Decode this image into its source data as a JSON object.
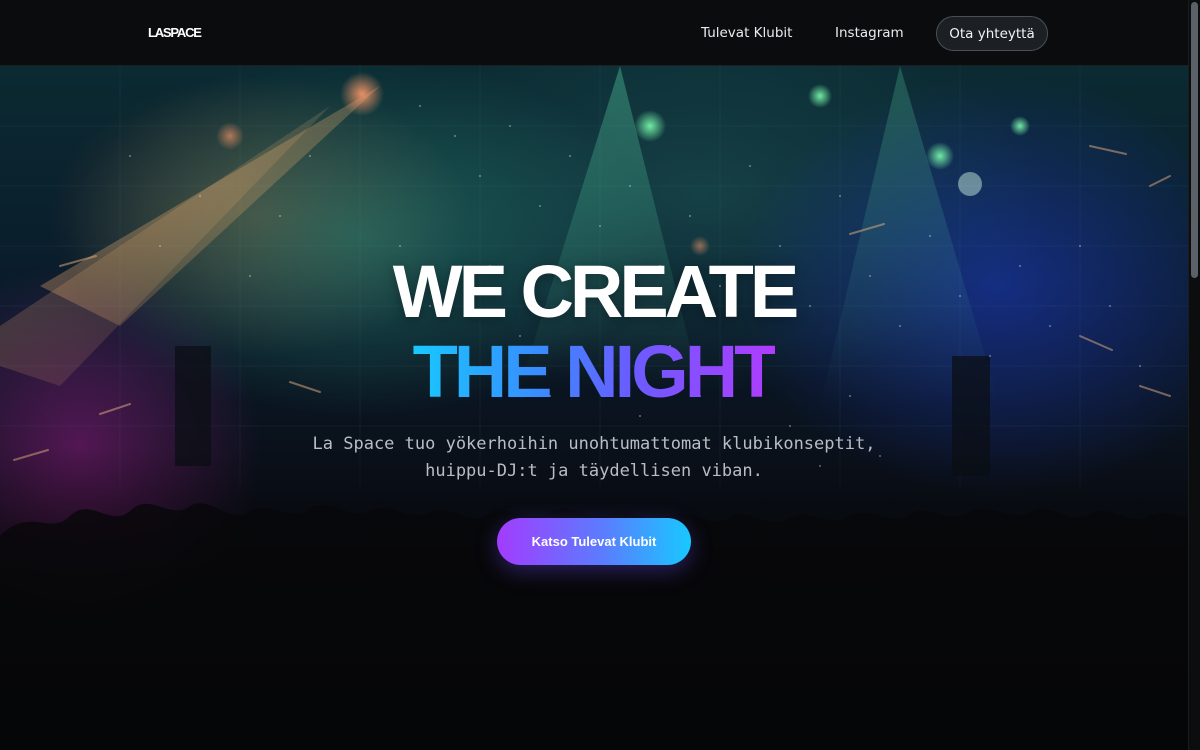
{
  "nav": {
    "logo": "LASPACE",
    "links": [
      {
        "label": "Tulevat Klubit"
      },
      {
        "label": "Instagram"
      }
    ],
    "contact_label": "Ota yhteyttä"
  },
  "hero": {
    "title_line1": "WE CREATE",
    "title_line2": "THE NIGHT",
    "subtitle": "La Space tuo yökerhoihin unohtumattomat klubikonseptit, huippu-DJ:t ja täydellisen viban.",
    "cta_label": "Katso Tulevat Klubit"
  },
  "colors": {
    "background": "#050607",
    "gradient_start": "#18c8ff",
    "gradient_end": "#b03cff",
    "cta_start": "#a23cff",
    "cta_end": "#18c8ff"
  }
}
